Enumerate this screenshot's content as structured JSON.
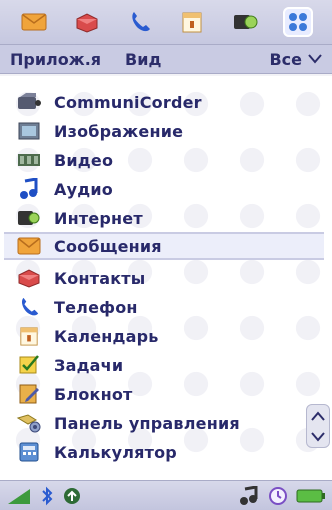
{
  "top_icons": [
    "messages-icon",
    "contacts-icon",
    "phone-icon",
    "calendar-icon",
    "internet-icon",
    "apps-grid-icon"
  ],
  "menubar": {
    "apps_label": "Прилож.я",
    "view_label": "Вид",
    "filter_label": "Все"
  },
  "list": {
    "items": [
      {
        "label": "CommuniCorder",
        "icon": "communicorder-icon"
      },
      {
        "label": "Изображение",
        "icon": "image-icon"
      },
      {
        "label": "Видео",
        "icon": "video-icon"
      },
      {
        "label": "Аудио",
        "icon": "audio-icon"
      },
      {
        "label": "Интернет",
        "icon": "internet-icon"
      },
      {
        "label": "Сообщения",
        "icon": "messages-icon",
        "selected": true
      },
      {
        "label": "Контакты",
        "icon": "contacts-icon"
      },
      {
        "label": "Телефон",
        "icon": "phone-icon"
      },
      {
        "label": "Календарь",
        "icon": "calendar-icon"
      },
      {
        "label": "Задачи",
        "icon": "tasks-icon"
      },
      {
        "label": "Блокнот",
        "icon": "notepad-icon"
      },
      {
        "label": "Панель управления",
        "icon": "control-panel-icon"
      },
      {
        "label": "Калькулятор",
        "icon": "calculator-icon"
      }
    ]
  },
  "status": {
    "icons": [
      "signal-strength-icon",
      "bluetooth-icon",
      "gprs-icon",
      "music-icon",
      "clock-icon",
      "battery-icon"
    ]
  },
  "colors": {
    "text": "#28296a",
    "bar": "#c9cbe3",
    "selection": "#eceefa"
  }
}
